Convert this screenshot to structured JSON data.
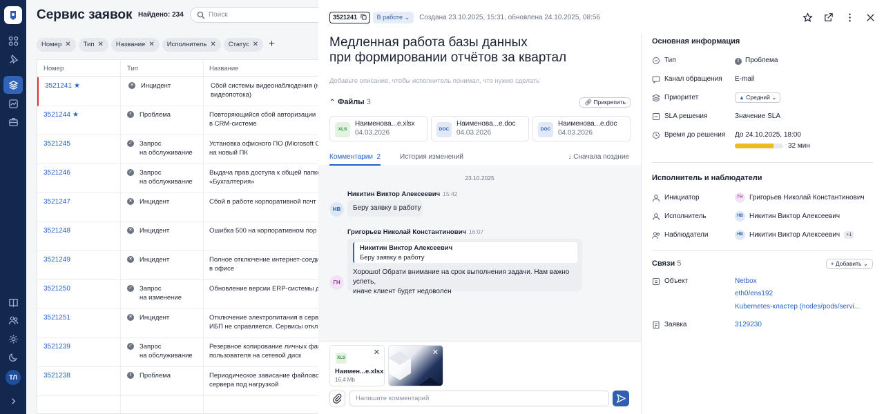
{
  "app": {
    "title": "Сервис заявок",
    "found": "Найдено: 234",
    "search_placeholder": "Поиск",
    "user_initials": "ТЛ"
  },
  "filters": [
    "Номер",
    "Тип",
    "Название",
    "Исполнитель",
    "Статус"
  ],
  "table": {
    "columns": [
      "Номер",
      "Тип",
      "Название"
    ],
    "rows": [
      {
        "num": "3521241",
        "star": true,
        "type": "Инцидент",
        "icon": "x",
        "name": "Сбой системы видеонаблюдения (не\nвидеопотока)"
      },
      {
        "num": "3521244",
        "star": true,
        "type": "Проблема",
        "icon": "!",
        "name": "Повторяющийся сбой авторизации\nв CRM-системе"
      },
      {
        "num": "3521245",
        "star": false,
        "type": "Запрос\nна обслуживание",
        "icon": "check",
        "name": "Установка офисного ПО (Microsoft O\nна новый ПК"
      },
      {
        "num": "3521246",
        "star": false,
        "type": "Запрос\nна обслуживание",
        "icon": "check",
        "name": "Выдача прав доступа к общей папке\n«Бухгалтерия»"
      },
      {
        "num": "3521247",
        "star": false,
        "type": "Инцидент",
        "icon": "x",
        "name": "Сбой в работе корпоративной почт"
      },
      {
        "num": "3521248",
        "star": false,
        "type": "Инцидент",
        "icon": "x",
        "name": "Ошибка 500 на корпоративном пор"
      },
      {
        "num": "3521249",
        "star": false,
        "type": "Инцидент",
        "icon": "x",
        "name": "Полное отключение интернет-соеди\nв офисе"
      },
      {
        "num": "3521250",
        "star": false,
        "type": "Запрос\nна изменение",
        "icon": "check",
        "name": "Обновление версии ERP-системы до"
      },
      {
        "num": "3521251",
        "star": false,
        "type": "Инцидент",
        "icon": "x",
        "name": "Отключение электропитания в серв\nИБП не справляется. Сервисы откл"
      },
      {
        "num": "3521239",
        "star": false,
        "type": "Запрос\nна обслуживание",
        "icon": "check",
        "name": "Резервное копирование личных фай\nпользователя на сетевой диск"
      },
      {
        "num": "3521238",
        "star": false,
        "type": "Проблема",
        "icon": "!",
        "name": "Периодическое зависание файловог\nсервера под нагрузкой"
      }
    ]
  },
  "ticket": {
    "id": "3521241",
    "status": "В работе",
    "created": "Создана 23.10.2025, 15:31, обновлена 24.10.2025, 08:56",
    "title": "Медленная работа базы данных\nпри формировании отчётов за квартал",
    "description_placeholder": "Добавьте описание, чтобы исполнитель понимал, что нужно сделать",
    "files_label": "Файлы",
    "files_count": "3",
    "attach_label": "Прикрепить",
    "files": [
      {
        "name": "Наименова...e.xlsx",
        "date": "04.03.2026",
        "ext": "XLS",
        "color": "#e2f3e2",
        "fg": "#2e8b3a"
      },
      {
        "name": "Наименова...e.doc",
        "date": "04.03.2026",
        "ext": "DOC",
        "color": "#e1e9f8",
        "fg": "#2f5fb0"
      },
      {
        "name": "Наименова...e.doc",
        "date": "04.03.2026",
        "ext": "DOC",
        "color": "#e1e9f8",
        "fg": "#2f5fb0"
      }
    ]
  },
  "tabs": {
    "comments": "Комментарии",
    "comments_count": "2",
    "history": "История изменений",
    "sort": "Сначала поздние"
  },
  "chat": {
    "date": "23.10.2025",
    "m1": {
      "author": "Никитин Виктор Алексеевич",
      "time": "15:42",
      "text": "Беру заявку в работу",
      "initials": "НВ"
    },
    "m2": {
      "author": "Григорьев Николай Константинович",
      "time": "16:07",
      "quote_author": "Никитин Виктор Алексеевич",
      "quote_text": "Беру заявку в работу",
      "text": "Хорошо! Обрати внимание на срок выполнения задачи. Нам важно успеть,\nиначе клиент будет недоволен",
      "initials": "ГН"
    }
  },
  "composer": {
    "upload_name": "Наимен...e.xlsx",
    "upload_size": "16,4 Mb",
    "upload_ext": "XLS",
    "placeholder": "Напишите комментарий"
  },
  "info": {
    "section": "Основная информация",
    "type_label": "Тип",
    "type_value": "Проблема",
    "channel_label": "Канал обращения",
    "channel_value": "E-mail",
    "priority_label": "Приоритет",
    "priority_value": "Средний",
    "sla_label": "SLA решения",
    "sla_value": "Значение SLA",
    "deadline_label": "Время до решения",
    "deadline_value": "До 24.10.2025, 18:00",
    "remaining": "32 мин",
    "progress": 0.8
  },
  "people": {
    "section": "Исполнитель и наблюдатели",
    "initiator_label": "Инициатор",
    "initiator": "Григорьев Николай Константинович",
    "initiator_initials": "ГН",
    "assignee_label": "Исполнитель",
    "assignee": "Никитин Виктор Алексеевич",
    "assignee_initials": "НВ",
    "watchers_label": "Наблюдатели",
    "watchers": "Никитин Виктор Алексеевич",
    "watchers_initials": "НВ",
    "watchers_more": "+1"
  },
  "links": {
    "section": "Связи",
    "count": "5",
    "add_label": "Добавить",
    "object_label": "Объект",
    "objects": [
      "Netbox",
      "eth0/ens192",
      "Kubernetes-кластер (nodes/pods/servi..."
    ],
    "ticket_label": "Заявка",
    "ticket_value": "3129230"
  },
  "colors": {
    "rail": "#13284e",
    "accent": "#2563c9",
    "selected": "#d93030",
    "sla_bar": "#f2b824"
  }
}
